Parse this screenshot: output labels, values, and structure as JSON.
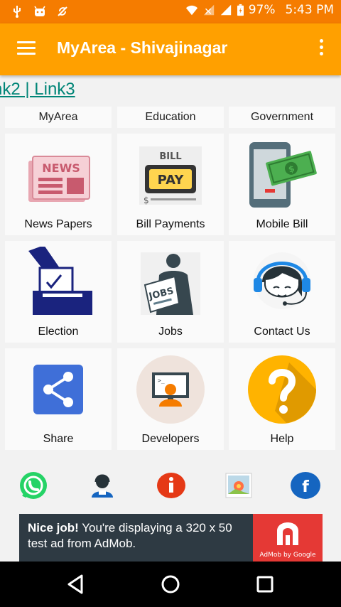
{
  "status_bar": {
    "battery": "97%",
    "time": "5:43 PM"
  },
  "app_bar": {
    "title": "MyArea - Shivajinagar"
  },
  "marquee": {
    "text": "nk2 | Link3"
  },
  "tabs": [
    "MyArea",
    "Education",
    "Government"
  ],
  "tiles": [
    {
      "label": "News Papers"
    },
    {
      "label": "Bill Payments"
    },
    {
      "label": "Mobile Bill"
    },
    {
      "label": "Election"
    },
    {
      "label": "Jobs"
    },
    {
      "label": "Contact Us"
    },
    {
      "label": "Share"
    },
    {
      "label": "Developers"
    },
    {
      "label": "Help"
    }
  ],
  "art_text": {
    "news": "NEWS",
    "bill": "BILL",
    "pay": "PAY",
    "jobs": "JOBS"
  },
  "ad": {
    "bold": "Nice job!",
    "text": " You're displaying a 320 x 50 test ad from AdMob.",
    "caption": "AdMob by Google"
  },
  "colors": {
    "status_bar": "#f57c00",
    "app_bar": "#ffa000",
    "link": "#008577"
  }
}
